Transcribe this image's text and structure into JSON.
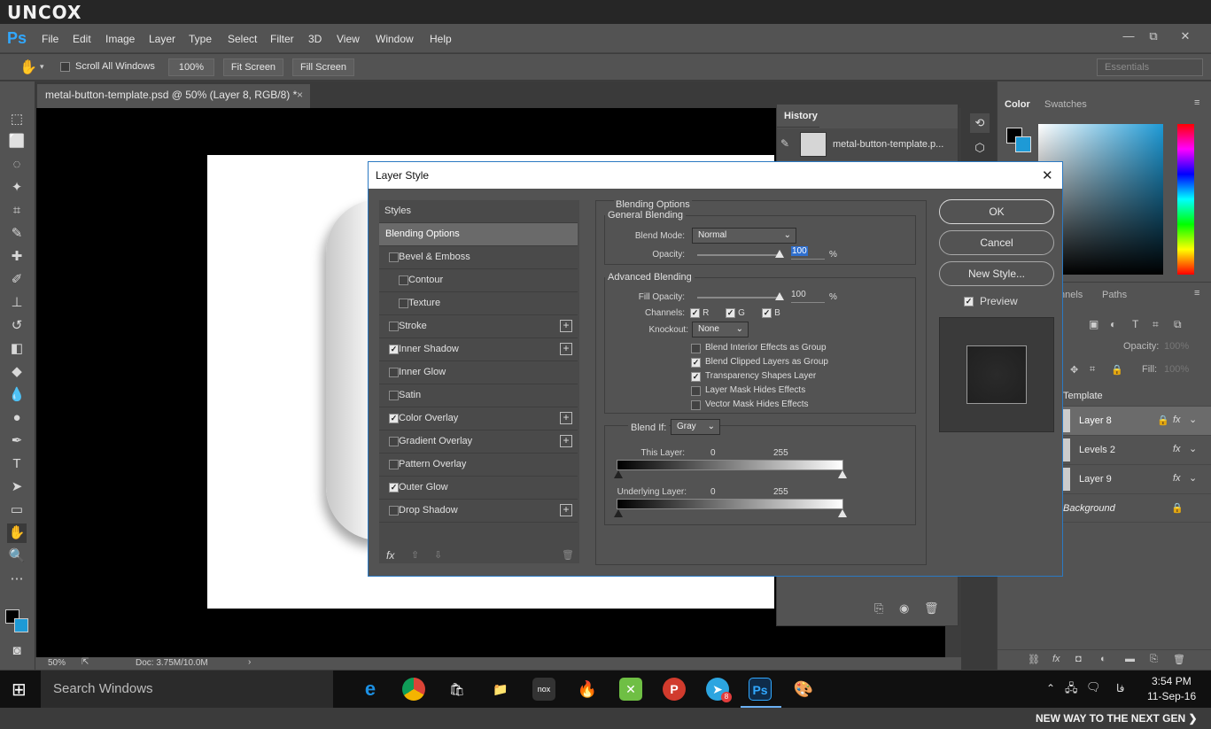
{
  "brand": {
    "logo": "UNCOX",
    "tagline": "NEW WAY TO THE NEXT GEN ❯"
  },
  "app": {
    "logo": "Ps",
    "menu": [
      "File",
      "Edit",
      "Image",
      "Layer",
      "Type",
      "Select",
      "Filter",
      "3D",
      "View",
      "Window",
      "Help"
    ],
    "window_buttons": [
      "—",
      "⧉",
      "✕"
    ]
  },
  "options_bar": {
    "scroll_all": "Scroll All Windows",
    "zoom": "100%",
    "fit_screen": "Fit Screen",
    "fill_screen": "Fill Screen",
    "workspace": "Essentials"
  },
  "document": {
    "tab_title": "metal-button-template.psd @ 50% (Layer 8, RGB/8) *",
    "close": "×"
  },
  "status_bar": {
    "zoom": "50%",
    "doc": "Doc: 3.75M/10.0M"
  },
  "history": {
    "title": "History",
    "item": "metal-button-template.p..."
  },
  "color_panel": {
    "tabs": [
      "Color",
      "Swatches"
    ]
  },
  "layers_panel": {
    "tabs": [
      "nnels",
      "Paths"
    ],
    "opacity_label": "Opacity:",
    "opacity": "100%",
    "fill_label": "Fill:",
    "fill": "100%",
    "group": "Template",
    "layers": [
      {
        "name": "Layer 8",
        "fx": "fx"
      },
      {
        "name": "Levels 2",
        "fx": "fx"
      },
      {
        "name": "Layer 9",
        "fx": "fx"
      },
      {
        "name": "Background",
        "fx": ""
      }
    ]
  },
  "dialog": {
    "title": "Layer Style",
    "close": "✕",
    "styles_header": "Styles",
    "blending_options": "Blending Options",
    "styles": [
      {
        "label": "Bevel & Emboss",
        "checked": false,
        "plus": false,
        "indent": false
      },
      {
        "label": "Contour",
        "checked": false,
        "plus": false,
        "indent": true
      },
      {
        "label": "Texture",
        "checked": false,
        "plus": false,
        "indent": true
      },
      {
        "label": "Stroke",
        "checked": false,
        "plus": true,
        "indent": false
      },
      {
        "label": "Inner Shadow",
        "checked": true,
        "plus": true,
        "indent": false
      },
      {
        "label": "Inner Glow",
        "checked": false,
        "plus": false,
        "indent": false
      },
      {
        "label": "Satin",
        "checked": false,
        "plus": false,
        "indent": false
      },
      {
        "label": "Color Overlay",
        "checked": true,
        "plus": true,
        "indent": false
      },
      {
        "label": "Gradient Overlay",
        "checked": false,
        "plus": true,
        "indent": false
      },
      {
        "label": "Pattern Overlay",
        "checked": false,
        "plus": false,
        "indent": false
      },
      {
        "label": "Outer Glow",
        "checked": true,
        "plus": false,
        "indent": false
      },
      {
        "label": "Drop Shadow",
        "checked": false,
        "plus": true,
        "indent": false
      }
    ],
    "fx_label": "fx",
    "blending": {
      "section": "Blending Options",
      "general": "General Blending",
      "blend_mode_label": "Blend Mode:",
      "blend_mode": "Normal",
      "opacity_label": "Opacity:",
      "opacity": "100",
      "pct": "%",
      "advanced": "Advanced Blending",
      "fill_label": "Fill Opacity:",
      "fill": "100",
      "channels_label": "Channels:",
      "channels": [
        "R",
        "G",
        "B"
      ],
      "knockout_label": "Knockout:",
      "knockout": "None",
      "options": [
        {
          "label": "Blend Interior Effects as Group",
          "checked": false
        },
        {
          "label": "Blend Clipped Layers as Group",
          "checked": true
        },
        {
          "label": "Transparency Shapes Layer",
          "checked": true
        },
        {
          "label": "Layer Mask Hides Effects",
          "checked": false
        },
        {
          "label": "Vector Mask Hides Effects",
          "checked": false
        }
      ],
      "blend_if_label": "Blend If:",
      "blend_if": "Gray",
      "this_layer": "This Layer:",
      "underlying": "Underlying Layer:",
      "low": "0",
      "high": "255"
    },
    "buttons": {
      "ok": "OK",
      "cancel": "Cancel",
      "new_style": "New Style...",
      "preview": "Preview"
    }
  },
  "taskbar": {
    "search": "Search Windows",
    "time": "3:54 PM",
    "date": "11-Sep-16",
    "lang": "فا",
    "badge": "8"
  }
}
